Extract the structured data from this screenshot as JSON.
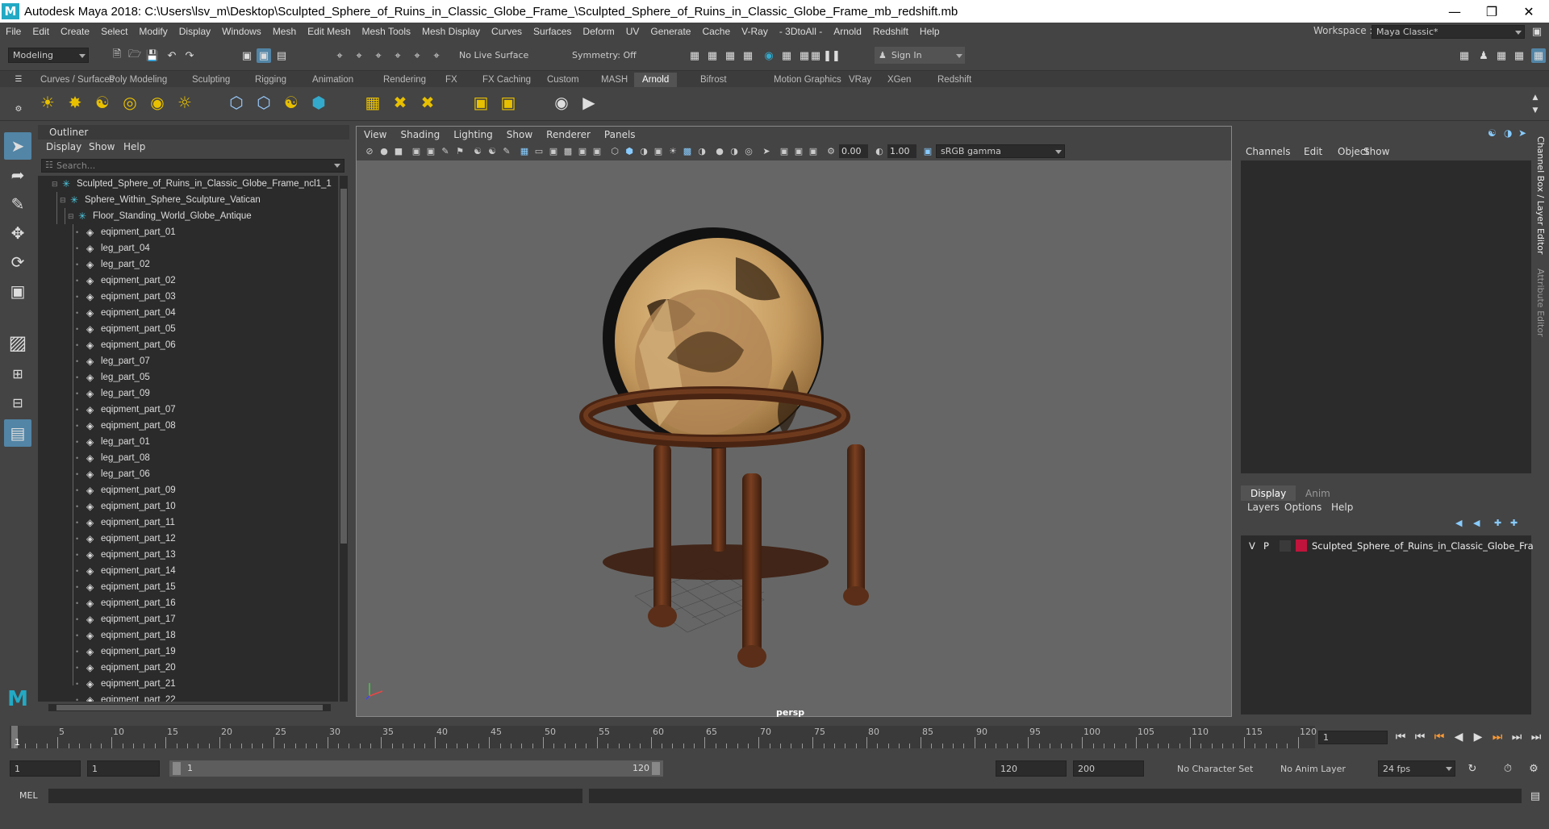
{
  "window": {
    "title": "Autodesk Maya 2018: C:\\Users\\lsv_m\\Desktop\\Sculpted_Sphere_of_Ruins_in_Classic_Globe_Frame_\\Sculpted_Sphere_of_Ruins_in_Classic_Globe_Frame_mb_redshift.mb",
    "logo": "M"
  },
  "menubar": [
    "File",
    "Edit",
    "Create",
    "Select",
    "Modify",
    "Display",
    "Windows",
    "Mesh",
    "Edit Mesh",
    "Mesh Tools",
    "Mesh Display",
    "Curves",
    "Surfaces",
    "Deform",
    "UV",
    "Generate",
    "Cache",
    "V-Ray",
    "- 3DtoAll -",
    "Arnold",
    "Redshift",
    "Help"
  ],
  "workspace": {
    "label": "Workspace :",
    "value": "Maya Classic*"
  },
  "status_line": {
    "menuset": "Modeling",
    "live_surface": "No Live Surface",
    "symmetry": "Symmetry: Off",
    "sign_in": "Sign In"
  },
  "shelf_tabs": [
    "Curves / Surfaces",
    "Poly Modeling",
    "Sculpting",
    "Rigging",
    "Animation",
    "Rendering",
    "FX",
    "FX Caching",
    "Custom",
    "MASH",
    "Arnold",
    "Bifrost",
    "Motion Graphics",
    "VRay",
    "XGen",
    "Redshift"
  ],
  "active_shelf_tab": "Arnold",
  "outliner": {
    "title": "Outliner",
    "menus": [
      "Display",
      "Show",
      "Help"
    ],
    "search_placeholder": "Search...",
    "items": [
      {
        "name": "Sculpted_Sphere_of_Ruins_in_Classic_Globe_Frame_ncl1_1",
        "type": "group",
        "level": 0
      },
      {
        "name": "Sphere_Within_Sphere_Sculpture_Vatican",
        "type": "group",
        "level": 1
      },
      {
        "name": "Floor_Standing_World_Globe_Antique",
        "type": "group",
        "level": 2
      },
      {
        "name": "eqipment_part_01",
        "type": "mesh",
        "level": 3
      },
      {
        "name": "leg_part_04",
        "type": "mesh",
        "level": 3
      },
      {
        "name": "leg_part_02",
        "type": "mesh",
        "level": 3
      },
      {
        "name": "eqipment_part_02",
        "type": "mesh",
        "level": 3
      },
      {
        "name": "eqipment_part_03",
        "type": "mesh",
        "level": 3
      },
      {
        "name": "eqipment_part_04",
        "type": "mesh",
        "level": 3
      },
      {
        "name": "eqipment_part_05",
        "type": "mesh",
        "level": 3
      },
      {
        "name": "eqipment_part_06",
        "type": "mesh",
        "level": 3
      },
      {
        "name": "leg_part_07",
        "type": "mesh",
        "level": 3
      },
      {
        "name": "leg_part_05",
        "type": "mesh",
        "level": 3
      },
      {
        "name": "leg_part_09",
        "type": "mesh",
        "level": 3
      },
      {
        "name": "eqipment_part_07",
        "type": "mesh",
        "level": 3
      },
      {
        "name": "eqipment_part_08",
        "type": "mesh",
        "level": 3
      },
      {
        "name": "leg_part_01",
        "type": "mesh",
        "level": 3
      },
      {
        "name": "leg_part_08",
        "type": "mesh",
        "level": 3
      },
      {
        "name": "leg_part_06",
        "type": "mesh",
        "level": 3
      },
      {
        "name": "eqipment_part_09",
        "type": "mesh",
        "level": 3
      },
      {
        "name": "eqipment_part_10",
        "type": "mesh",
        "level": 3
      },
      {
        "name": "eqipment_part_11",
        "type": "mesh",
        "level": 3
      },
      {
        "name": "eqipment_part_12",
        "type": "mesh",
        "level": 3
      },
      {
        "name": "eqipment_part_13",
        "type": "mesh",
        "level": 3
      },
      {
        "name": "eqipment_part_14",
        "type": "mesh",
        "level": 3
      },
      {
        "name": "eqipment_part_15",
        "type": "mesh",
        "level": 3
      },
      {
        "name": "eqipment_part_16",
        "type": "mesh",
        "level": 3
      },
      {
        "name": "eqipment_part_17",
        "type": "mesh",
        "level": 3
      },
      {
        "name": "eqipment_part_18",
        "type": "mesh",
        "level": 3
      },
      {
        "name": "eqipment_part_19",
        "type": "mesh",
        "level": 3
      },
      {
        "name": "eqipment_part_20",
        "type": "mesh",
        "level": 3
      },
      {
        "name": "eqipment_part_21",
        "type": "mesh",
        "level": 3
      },
      {
        "name": "eqipment_part_22",
        "type": "mesh",
        "level": 3
      }
    ]
  },
  "viewport": {
    "menus": [
      "View",
      "Shading",
      "Lighting",
      "Show",
      "Renderer",
      "Panels"
    ],
    "exposure": "0.00",
    "gamma": "1.00",
    "color_space": "sRGB gamma",
    "camera_label": "persp",
    "axis_labels": {
      "y": "y",
      "x": "x",
      "z": "z"
    }
  },
  "channel_box": {
    "menus": [
      "Channels",
      "Edit",
      "Object",
      "Show"
    ]
  },
  "layer_editor": {
    "tabs": [
      "Display",
      "Anim"
    ],
    "active_tab": "Display",
    "menus": [
      "Layers",
      "Options",
      "Help"
    ],
    "layers": [
      {
        "visible": "V",
        "playback": "P",
        "color": "#c0143c",
        "name": "Sculpted_Sphere_of_Ruins_in_Classic_Globe_Frame"
      }
    ]
  },
  "side_tabs": [
    "Channel Box / Layer Editor",
    "Attribute Editor"
  ],
  "time_slider": {
    "tick_labels": [
      "5",
      "10",
      "15",
      "20",
      "25",
      "30",
      "35",
      "40",
      "45",
      "50",
      "55",
      "60",
      "65",
      "70",
      "75",
      "80",
      "85",
      "90",
      "95",
      "100",
      "105",
      "110",
      "115",
      "120"
    ],
    "current_frame_marker": "1",
    "current_frame_field": "1"
  },
  "range_slider": {
    "start_frame": "1",
    "playback_start": "1",
    "range_start": "1",
    "range_end": "120",
    "playback_end": "120",
    "end_frame": "200",
    "character_set": "No Character Set",
    "anim_layer": "No Anim Layer",
    "fps": "24 fps"
  },
  "command_line": {
    "label": "MEL"
  },
  "colors": {
    "accent": "#5285a6",
    "panel": "#444444",
    "field": "#2b2b2b",
    "viewport_bg": "#666666",
    "globe": "#c9a36b",
    "wood": "#5a2e18"
  }
}
